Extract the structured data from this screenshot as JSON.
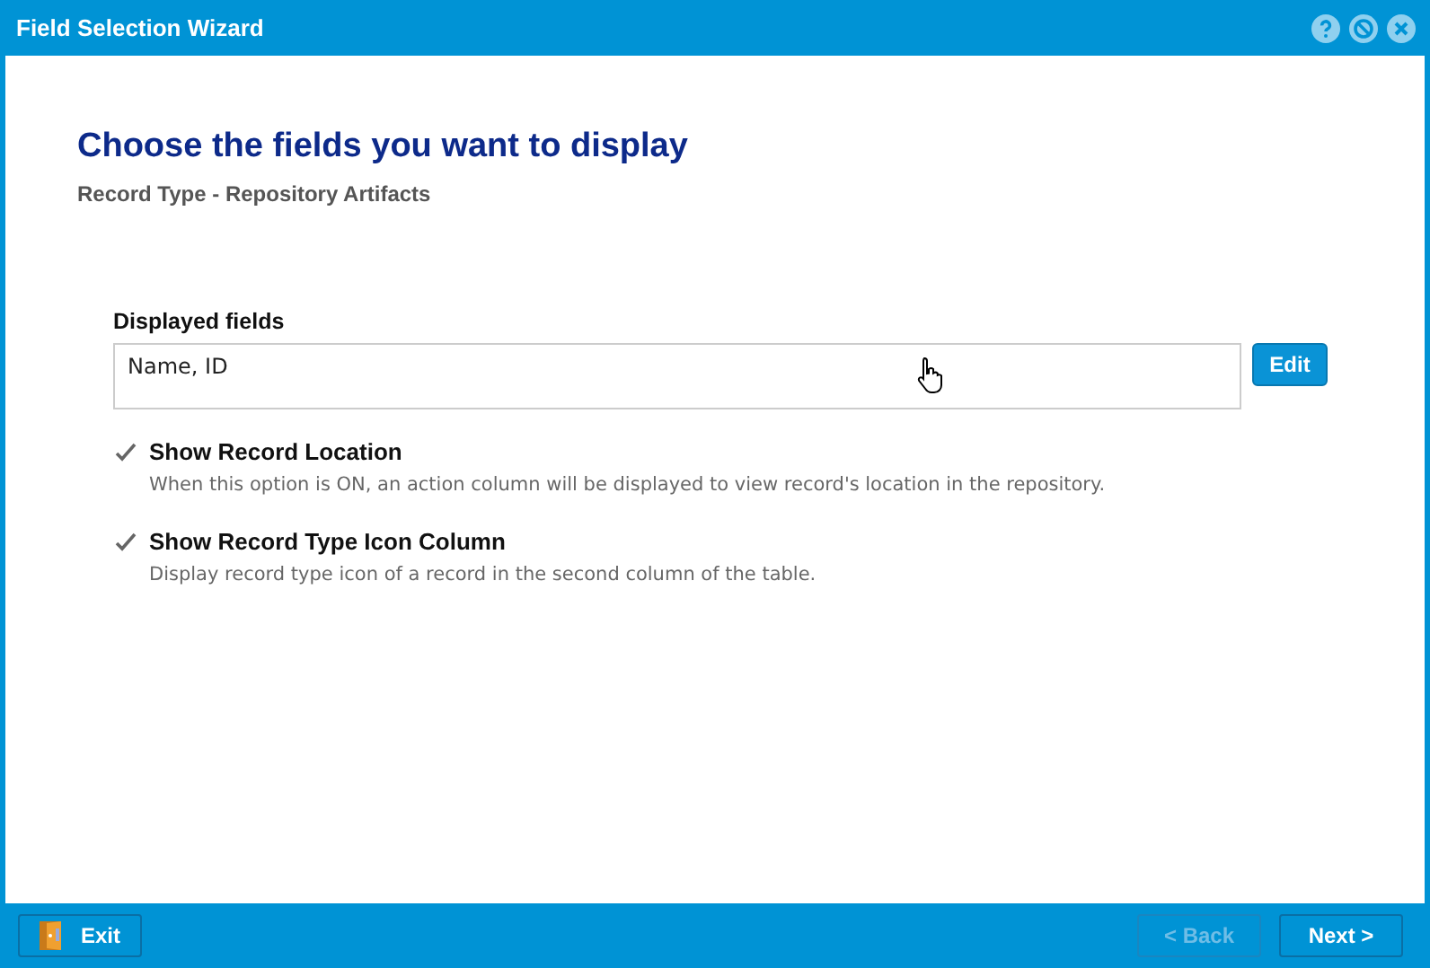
{
  "window": {
    "title": "Field Selection Wizard"
  },
  "heading": "Choose the fields you want to display",
  "subheading": "Record Type - Repository Artifacts",
  "displayed_fields": {
    "label": "Displayed fields",
    "value": "Name, ID",
    "button": "Edit"
  },
  "options": [
    {
      "label": "Show Record Location",
      "checked": true,
      "description": "When this option is ON, an action column will be displayed to view record's location in the repository."
    },
    {
      "label": "Show Record Type Icon Column",
      "checked": true,
      "description": "Display record type icon of a record in the second column of the table."
    }
  ],
  "footer": {
    "exit": "Exit",
    "buttons": [
      {
        "label": "< Back",
        "disabled": true
      },
      {
        "label": "Next >",
        "disabled": false
      }
    ]
  }
}
